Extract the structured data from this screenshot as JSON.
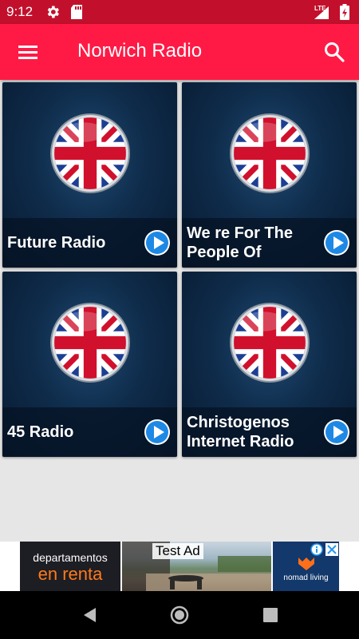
{
  "status_bar": {
    "time": "9:12",
    "network": "LTE",
    "icons": [
      "gear-icon",
      "sd-card-icon",
      "signal-icon",
      "battery-charging-icon"
    ]
  },
  "app_bar": {
    "title": "Norwich Radio",
    "menu_icon": "hamburger-menu-icon",
    "search_icon": "search-icon",
    "background": "#ff1a45"
  },
  "stations": [
    {
      "name": "Future Radio",
      "icon": "uk-flag-icon"
    },
    {
      "name": "We re For The People Of",
      "icon": "uk-flag-icon"
    },
    {
      "name": "45 Radio",
      "icon": "uk-flag-icon"
    },
    {
      "name": "Christogenos Internet Radio",
      "icon": "uk-flag-icon"
    }
  ],
  "ad": {
    "label": "Test Ad",
    "line1": "departamentos",
    "line2": "en renta",
    "brand": "nomad living"
  },
  "colors": {
    "accent": "#ff1a45",
    "status_bar": "#c2102c",
    "play": "#1e88e5"
  }
}
